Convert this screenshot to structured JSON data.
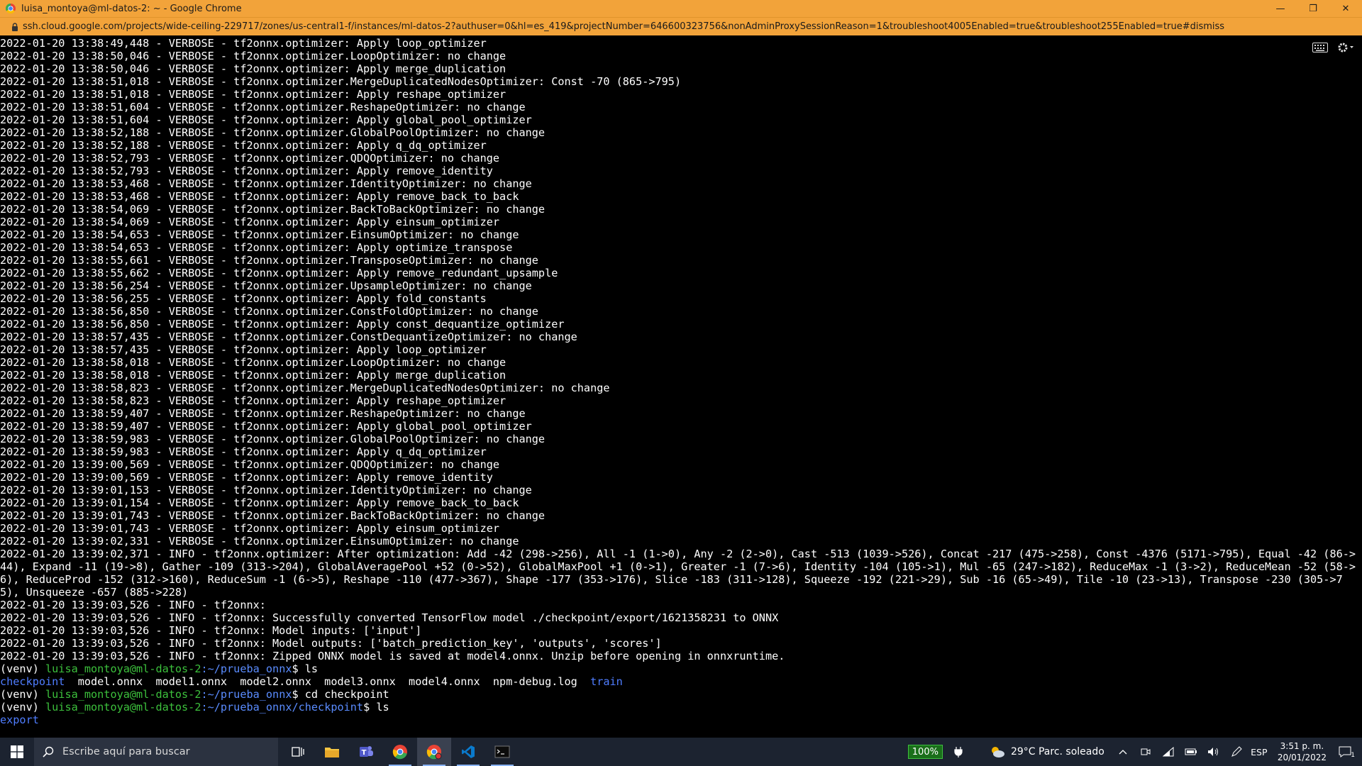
{
  "window": {
    "title": "luisa_montoya@ml-datos-2: ~ - Google Chrome",
    "url": "ssh.cloud.google.com/projects/wide-ceiling-229717/zones/us-central1-f/instances/ml-datos-2?authuser=0&hl=es_419&projectNumber=646600323756&nonAdminProxySessionReason=1&troubleshoot4005Enabled=true&troubleshoot255Enabled=true#dismiss",
    "controls": {
      "minimize": "—",
      "restore": "❐",
      "close": "✕"
    }
  },
  "terminal": {
    "log_lines": [
      "2022-01-20 13:38:49,448 - VERBOSE - tf2onnx.optimizer: Apply loop_optimizer",
      "2022-01-20 13:38:50,046 - VERBOSE - tf2onnx.optimizer.LoopOptimizer: no change",
      "2022-01-20 13:38:50,046 - VERBOSE - tf2onnx.optimizer: Apply merge_duplication",
      "2022-01-20 13:38:51,018 - VERBOSE - tf2onnx.optimizer.MergeDuplicatedNodesOptimizer: Const -70 (865->795)",
      "2022-01-20 13:38:51,018 - VERBOSE - tf2onnx.optimizer: Apply reshape_optimizer",
      "2022-01-20 13:38:51,604 - VERBOSE - tf2onnx.optimizer.ReshapeOptimizer: no change",
      "2022-01-20 13:38:51,604 - VERBOSE - tf2onnx.optimizer: Apply global_pool_optimizer",
      "2022-01-20 13:38:52,188 - VERBOSE - tf2onnx.optimizer.GlobalPoolOptimizer: no change",
      "2022-01-20 13:38:52,188 - VERBOSE - tf2onnx.optimizer: Apply q_dq_optimizer",
      "2022-01-20 13:38:52,793 - VERBOSE - tf2onnx.optimizer.QDQOptimizer: no change",
      "2022-01-20 13:38:52,793 - VERBOSE - tf2onnx.optimizer: Apply remove_identity",
      "2022-01-20 13:38:53,468 - VERBOSE - tf2onnx.optimizer.IdentityOptimizer: no change",
      "2022-01-20 13:38:53,468 - VERBOSE - tf2onnx.optimizer: Apply remove_back_to_back",
      "2022-01-20 13:38:54,069 - VERBOSE - tf2onnx.optimizer.BackToBackOptimizer: no change",
      "2022-01-20 13:38:54,069 - VERBOSE - tf2onnx.optimizer: Apply einsum_optimizer",
      "2022-01-20 13:38:54,653 - VERBOSE - tf2onnx.optimizer.EinsumOptimizer: no change",
      "2022-01-20 13:38:54,653 - VERBOSE - tf2onnx.optimizer: Apply optimize_transpose",
      "2022-01-20 13:38:55,661 - VERBOSE - tf2onnx.optimizer.TransposeOptimizer: no change",
      "2022-01-20 13:38:55,662 - VERBOSE - tf2onnx.optimizer: Apply remove_redundant_upsample",
      "2022-01-20 13:38:56,254 - VERBOSE - tf2onnx.optimizer.UpsampleOptimizer: no change",
      "2022-01-20 13:38:56,255 - VERBOSE - tf2onnx.optimizer: Apply fold_constants",
      "2022-01-20 13:38:56,850 - VERBOSE - tf2onnx.optimizer.ConstFoldOptimizer: no change",
      "2022-01-20 13:38:56,850 - VERBOSE - tf2onnx.optimizer: Apply const_dequantize_optimizer",
      "2022-01-20 13:38:57,435 - VERBOSE - tf2onnx.optimizer.ConstDequantizeOptimizer: no change",
      "2022-01-20 13:38:57,435 - VERBOSE - tf2onnx.optimizer: Apply loop_optimizer",
      "2022-01-20 13:38:58,018 - VERBOSE - tf2onnx.optimizer.LoopOptimizer: no change",
      "2022-01-20 13:38:58,018 - VERBOSE - tf2onnx.optimizer: Apply merge_duplication",
      "2022-01-20 13:38:58,823 - VERBOSE - tf2onnx.optimizer.MergeDuplicatedNodesOptimizer: no change",
      "2022-01-20 13:38:58,823 - VERBOSE - tf2onnx.optimizer: Apply reshape_optimizer",
      "2022-01-20 13:38:59,407 - VERBOSE - tf2onnx.optimizer.ReshapeOptimizer: no change",
      "2022-01-20 13:38:59,407 - VERBOSE - tf2onnx.optimizer: Apply global_pool_optimizer",
      "2022-01-20 13:38:59,983 - VERBOSE - tf2onnx.optimizer.GlobalPoolOptimizer: no change",
      "2022-01-20 13:38:59,983 - VERBOSE - tf2onnx.optimizer: Apply q_dq_optimizer",
      "2022-01-20 13:39:00,569 - VERBOSE - tf2onnx.optimizer.QDQOptimizer: no change",
      "2022-01-20 13:39:00,569 - VERBOSE - tf2onnx.optimizer: Apply remove_identity",
      "2022-01-20 13:39:01,153 - VERBOSE - tf2onnx.optimizer.IdentityOptimizer: no change",
      "2022-01-20 13:39:01,154 - VERBOSE - tf2onnx.optimizer: Apply remove_back_to_back",
      "2022-01-20 13:39:01,743 - VERBOSE - tf2onnx.optimizer.BackToBackOptimizer: no change",
      "2022-01-20 13:39:01,743 - VERBOSE - tf2onnx.optimizer: Apply einsum_optimizer",
      "2022-01-20 13:39:02,331 - VERBOSE - tf2onnx.optimizer.EinsumOptimizer: no change"
    ],
    "summary_line": "2022-01-20 13:39:02,371 - INFO - tf2onnx.optimizer: After optimization: Add -42 (298->256), All -1 (1->0), Any -2 (2->0), Cast -513 (1039->526), Concat -217 (475->258), Const -4376 (5171->795), Equal -42 (86->44), Expand -11 (19->8), Gather -109 (313->204), GlobalAveragePool +52 (0->52), GlobalMaxPool +1 (0->1), Greater -1 (7->6), Identity -104 (105->1), Mul -65 (247->182), ReduceMax -1 (3->2), ReduceMean -52 (58->6), ReduceProd -152 (312->160), ReduceSum -1 (6->5), Reshape -110 (477->367), Shape -177 (353->176), Slice -183 (311->128), Squeeze -192 (221->29), Sub -16 (65->49), Tile -10 (23->13), Transpose -230 (305->75), Unsqueeze -657 (885->228)",
    "info_lines": [
      "2022-01-20 13:39:03,526 - INFO - tf2onnx:",
      "2022-01-20 13:39:03,526 - INFO - tf2onnx: Successfully converted TensorFlow model ./checkpoint/export/1621358231 to ONNX",
      "2022-01-20 13:39:03,526 - INFO - tf2onnx: Model inputs: ['input']",
      "2022-01-20 13:39:03,526 - INFO - tf2onnx: Model outputs: ['batch_prediction_key', 'outputs', 'scores']",
      "2022-01-20 13:39:03,526 - INFO - tf2onnx: Zipped ONNX model is saved at model4.onnx. Unzip before opening in onnxruntime."
    ],
    "prompt1": {
      "venv": "(venv) ",
      "user": "luisa_montoya@ml-datos-2",
      "path": ":~/prueba_onnx",
      "cmd": "$ ls"
    },
    "ls_output": {
      "dir1": "checkpoint",
      "files": "  model.onnx  model1.onnx  model2.onnx  model3.onnx  model4.onnx  npm-debug.log  ",
      "dir2": "train"
    },
    "prompt2": {
      "venv": "(venv) ",
      "user": "luisa_montoya@ml-datos-2",
      "path": ":~/prueba_onnx",
      "cmd": "$ cd checkpoint"
    },
    "prompt3": {
      "venv": "(venv) ",
      "user": "luisa_montoya@ml-datos-2",
      "path": ":~/prueba_onnx/checkpoint",
      "cmd": "$ ls"
    },
    "ls_output2": "export"
  },
  "taskbar": {
    "search_placeholder": "Escribe aquí para buscar",
    "battery": "100%",
    "weather": "29°C  Parc. soleado",
    "language": "ESP",
    "time": "3:51 p. m.",
    "date": "20/01/2022",
    "notifications_count": "1"
  },
  "colors": {
    "titlebar": "#f2a33a",
    "terminal_bg": "#000000",
    "prompt_user": "#3cc03c",
    "prompt_path": "#5a8cff",
    "taskbar": "#1c2330"
  }
}
